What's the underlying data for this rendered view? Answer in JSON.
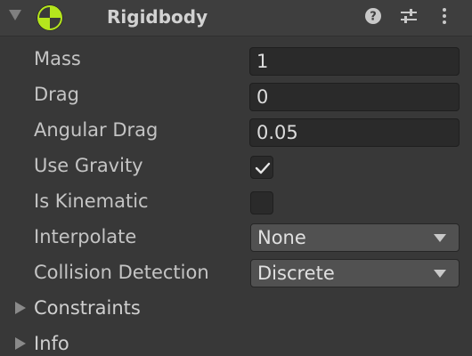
{
  "component": {
    "title": "Rigidbody",
    "enabled_icon": "rigidbody-icon",
    "header_icons": [
      "help-icon",
      "preset-sliders-icon",
      "kebab-menu-icon"
    ]
  },
  "fields": {
    "mass": {
      "label": "Mass",
      "value": "1"
    },
    "drag": {
      "label": "Drag",
      "value": "0"
    },
    "angular_drag": {
      "label": "Angular Drag",
      "value": "0.05"
    },
    "use_gravity": {
      "label": "Use Gravity",
      "checked": true
    },
    "is_kinematic": {
      "label": "Is Kinematic",
      "checked": false
    },
    "interpolate": {
      "label": "Interpolate",
      "selected": "None"
    },
    "collision_detection": {
      "label": "Collision Detection",
      "selected": "Discrete"
    }
  },
  "sections": {
    "constraints": {
      "label": "Constraints",
      "expanded": false
    },
    "info": {
      "label": "Info",
      "expanded": false
    }
  },
  "colors": {
    "background": "#383838",
    "header": "#3e3e3e",
    "field_bg": "#2a2a2a",
    "dropdown_bg": "#515151",
    "accent_green": "#b5e61d"
  }
}
